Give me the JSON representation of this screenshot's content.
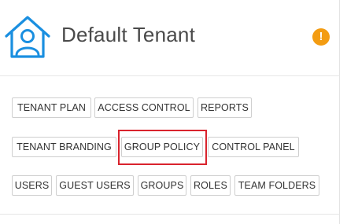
{
  "tenant": {
    "title": "Default Tenant",
    "alert_symbol": "!",
    "icon": "home-user-icon",
    "alert_icon": "warning-icon",
    "colors": {
      "icon_blue": "#1a8fe0",
      "alert_orange": "#f39c12",
      "highlight_red": "#d9232d"
    }
  },
  "buttons": {
    "tenant_plan": "TENANT PLAN",
    "access_control": "ACCESS CONTROL",
    "reports": "REPORTS",
    "tenant_branding": "TENANT BRANDING",
    "group_policy": "GROUP POLICY",
    "control_panel": "CONTROL PANEL",
    "users": "USERS",
    "guest_users": "GUEST USERS",
    "groups": "GROUPS",
    "roles": "ROLES",
    "team_folders": "TEAM FOLDERS"
  }
}
